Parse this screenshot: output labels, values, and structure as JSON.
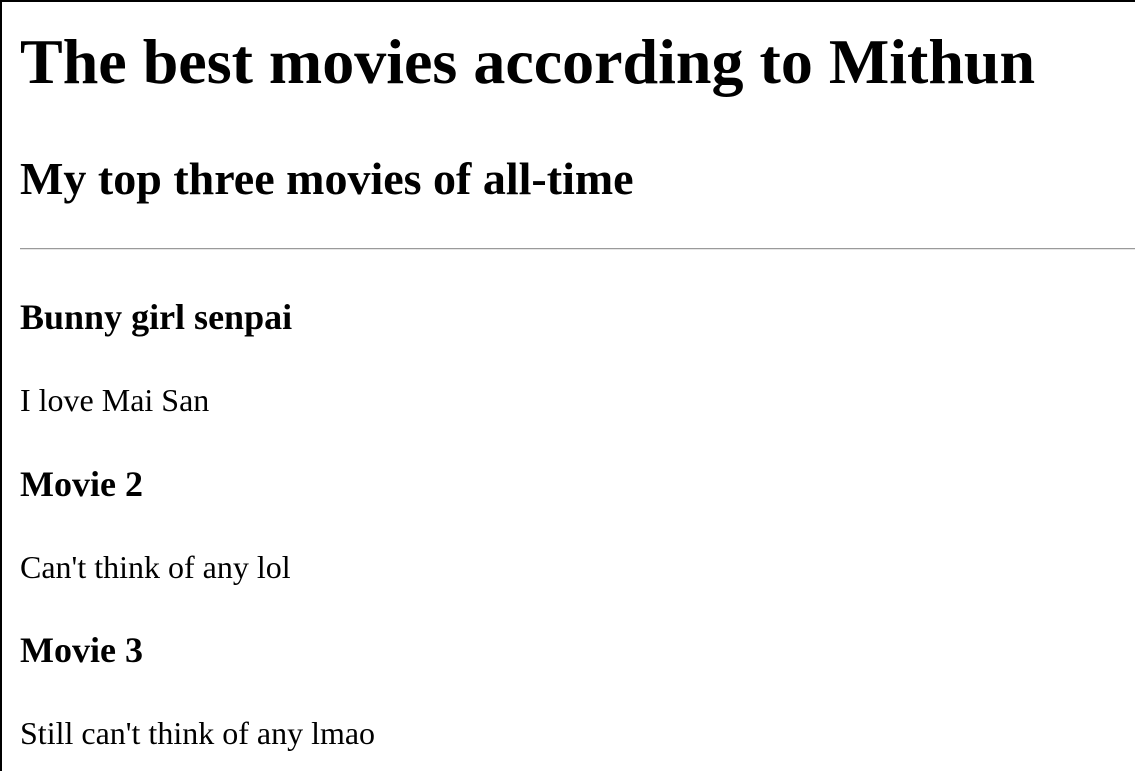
{
  "page": {
    "title": "The best movies according to Mithun",
    "subtitle": "My top three movies of all-time"
  },
  "movies": [
    {
      "title": "Bunny girl senpai",
      "description": "I love Mai San"
    },
    {
      "title": "Movie 2",
      "description": "Can't think of any lol"
    },
    {
      "title": "Movie 3",
      "description": "Still can't think of any lmao"
    }
  ]
}
